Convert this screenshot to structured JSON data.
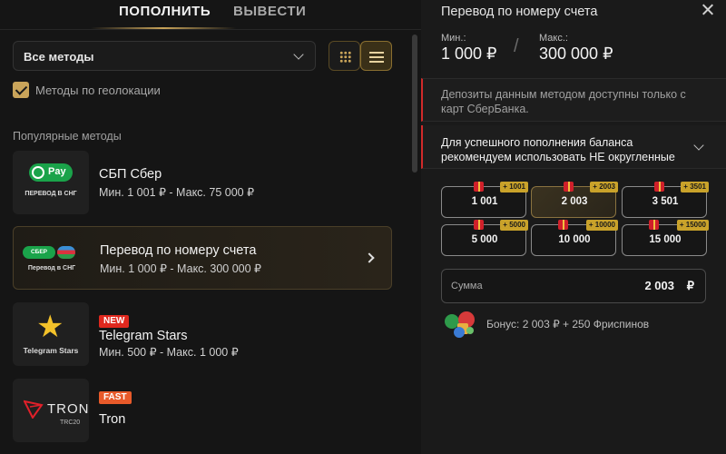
{
  "tabs": {
    "deposit": "ПОПОЛНИТЬ",
    "withdraw": "ВЫВЕСТИ"
  },
  "filter": {
    "selected": "Все методы",
    "geo_label": "Методы по геолокации",
    "geo_checked": true
  },
  "section_title": "Популярные методы",
  "methods": [
    {
      "logo_text": "Pay",
      "logo_caption": "ПЕРЕВОД В СНГ",
      "name": "СБП Сбер",
      "limits": "Мин. 1 001 ₽ - Макс. 75 000 ₽",
      "badge": ""
    },
    {
      "logo_text": "СБЕР",
      "logo_caption": "Перевод в СНГ",
      "name": "Перевод по номеру счета",
      "limits": "Мин. 1 000 ₽ - Макс. 300 000 ₽",
      "badge": ""
    },
    {
      "logo_text": "",
      "logo_caption": "Telegram Stars",
      "name": "Telegram Stars",
      "limits": "Мин. 500 ₽ - Макс. 1 000 ₽",
      "badge": "NEW"
    },
    {
      "logo_text": "TRON",
      "logo_caption": "TRC20",
      "name": "Tron",
      "limits": "",
      "badge": "FAST"
    }
  ],
  "panel": {
    "title": "Перевод по номеру счета",
    "min_label": "Мин.:",
    "min_value": "1 000 ₽",
    "max_label": "Макс.:",
    "max_value": "300 000 ₽",
    "separator": "/",
    "notice1": "Депозиты данным методом доступны только с карт СберБанка.",
    "notice2": "Для успешного пополнения баланса рекомендуем использовать НЕ округленные",
    "amounts": [
      {
        "value": "1 001",
        "bonus": "+ 1001",
        "selected": false
      },
      {
        "value": "2 003",
        "bonus": "+ 2003",
        "selected": true
      },
      {
        "value": "3 501",
        "bonus": "+ 3501",
        "selected": false
      },
      {
        "value": "5 000",
        "bonus": "+ 5000",
        "selected": false
      },
      {
        "value": "10 000",
        "bonus": "+ 10000",
        "selected": false
      },
      {
        "value": "15 000",
        "bonus": "+ 15000",
        "selected": false
      }
    ],
    "sum_label": "Сумма",
    "sum_value": "2 003",
    "currency": "₽",
    "bonus_text": "Бонус: 2 003 ₽ + 250 Фриспинов"
  },
  "colors": {
    "accent": "#c9a45a",
    "alert": "#d12a2a",
    "green": "#1aa34a",
    "new_badge": "#e0281e",
    "fast_badge": "#e85a2a"
  },
  "icons": [
    "chevron-down-icon",
    "grid-view-icon",
    "list-view-icon",
    "check-icon",
    "chevron-right-icon",
    "star-icon",
    "tron-icon",
    "close-icon",
    "gift-icon"
  ]
}
